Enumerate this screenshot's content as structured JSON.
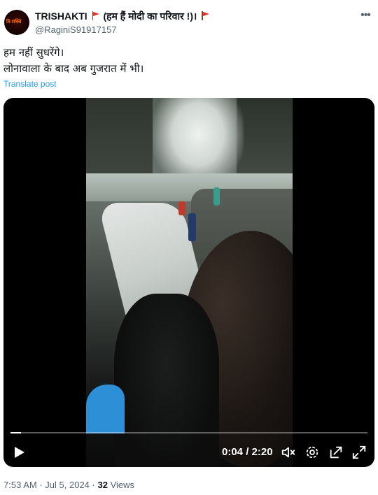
{
  "post": {
    "display_name": "TRISHAKTI",
    "display_name_suffix": "(हम हैं मोदी का परिवार !)।",
    "handle": "@RaginiS91917157",
    "text_line1": "हम नहीं सुधरेंगे।",
    "text_line2": "लोनावाला के बाद अब गुजरात में भी।",
    "translate_label": "Translate post",
    "avatar_text": "त्रि शक्ति",
    "icons": [
      "red-flag-icon",
      "more-options-icon"
    ]
  },
  "video": {
    "current_time": "0:04",
    "duration": "2:20",
    "time_display": "0:04 / 2:20",
    "progress_fraction": 0.03,
    "icons": [
      "play-icon",
      "volume-icon",
      "settings-icon",
      "pop-out-icon",
      "fullscreen-icon"
    ]
  },
  "meta": {
    "time": "7:53 AM",
    "date": "Jul 5, 2024",
    "separator": "·",
    "views_count": "32",
    "views_label": "Views"
  },
  "colors": {
    "link": "#1d9bf0",
    "secondary_text": "#536471",
    "flag": "#e0302a"
  }
}
